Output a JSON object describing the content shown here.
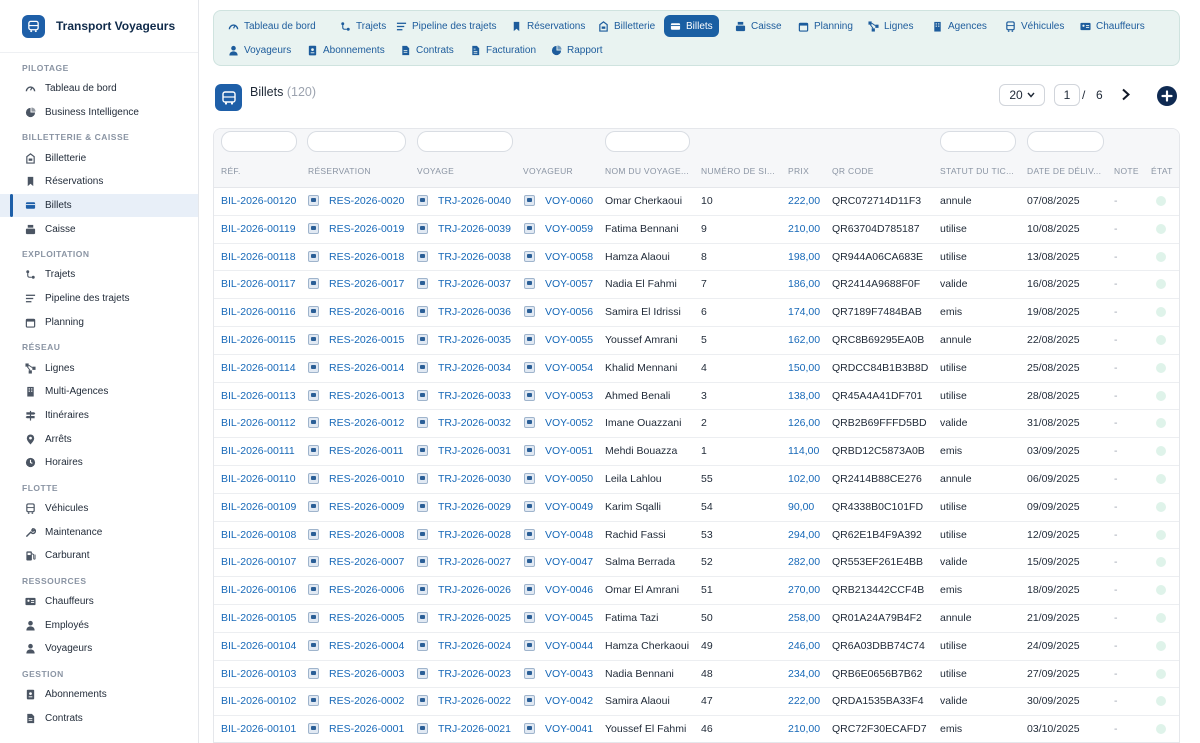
{
  "app": {
    "title": "Transport Voyageurs"
  },
  "sidebar": {
    "sections": [
      {
        "title": "PILOTAGE",
        "items": [
          {
            "label": "Tableau de bord",
            "icon": "gauge-icon"
          },
          {
            "label": "Business Intelligence",
            "icon": "chart-pie-icon"
          }
        ]
      },
      {
        "title": "BILLETTERIE & CAISSE",
        "items": [
          {
            "label": "Billetterie",
            "icon": "ticket-booth-icon"
          },
          {
            "label": "Réservations",
            "icon": "bookmark-icon"
          },
          {
            "label": "Billets",
            "icon": "ticket-icon",
            "active": true
          },
          {
            "label": "Caisse",
            "icon": "cash-register-icon"
          }
        ]
      },
      {
        "title": "EXPLOITATION",
        "items": [
          {
            "label": "Trajets",
            "icon": "route-icon"
          },
          {
            "label": "Pipeline des trajets",
            "icon": "pipeline-icon"
          },
          {
            "label": "Planning",
            "icon": "calendar-icon"
          }
        ]
      },
      {
        "title": "RÉSEAU",
        "items": [
          {
            "label": "Lignes",
            "icon": "network-icon"
          },
          {
            "label": "Multi-Agences",
            "icon": "building-icon"
          },
          {
            "label": "Itinéraires",
            "icon": "signpost-icon"
          },
          {
            "label": "Arrêts",
            "icon": "map-pin-icon"
          },
          {
            "label": "Horaires",
            "icon": "clock-icon"
          }
        ]
      },
      {
        "title": "FLOTTE",
        "items": [
          {
            "label": "Véhicules",
            "icon": "bus-icon"
          },
          {
            "label": "Maintenance",
            "icon": "wrench-icon"
          },
          {
            "label": "Carburant",
            "icon": "fuel-icon"
          }
        ]
      },
      {
        "title": "RESSOURCES",
        "items": [
          {
            "label": "Chauffeurs",
            "icon": "id-card-icon"
          },
          {
            "label": "Employés",
            "icon": "user-tie-icon"
          },
          {
            "label": "Voyageurs",
            "icon": "user-icon"
          }
        ]
      },
      {
        "title": "GESTION",
        "items": [
          {
            "label": "Abonnements",
            "icon": "id-badge-icon"
          },
          {
            "label": "Contrats",
            "icon": "file-icon"
          }
        ]
      }
    ]
  },
  "tabs": [
    {
      "label": "Tableau de bord",
      "icon": "gauge-icon"
    },
    {
      "label": "Trajets",
      "icon": "route-icon"
    },
    {
      "label": "Pipeline des trajets",
      "icon": "pipeline-icon"
    },
    {
      "label": "Réservations",
      "icon": "bookmark-icon"
    },
    {
      "label": "Billetterie",
      "icon": "ticket-booth-icon"
    },
    {
      "label": "Billets",
      "icon": "ticket-icon",
      "active": true
    },
    {
      "label": "Caisse",
      "icon": "cash-register-icon"
    },
    {
      "label": "Planning",
      "icon": "calendar-icon"
    },
    {
      "label": "Lignes",
      "icon": "network-icon"
    },
    {
      "label": "Agences",
      "icon": "building-icon"
    },
    {
      "label": "Véhicules",
      "icon": "bus-icon"
    },
    {
      "label": "Chauffeurs",
      "icon": "id-card-icon"
    },
    {
      "label": "Voyageurs",
      "icon": "user-icon"
    },
    {
      "label": "Abonnements",
      "icon": "id-badge-icon"
    },
    {
      "label": "Contrats",
      "icon": "file-icon"
    },
    {
      "label": "Facturation",
      "icon": "invoice-icon"
    },
    {
      "label": "Rapport",
      "icon": "chart-pie-icon"
    }
  ],
  "page": {
    "title": "Billets",
    "count": "(120)"
  },
  "pagination": {
    "page_size": "20",
    "current_page": "1",
    "separator": "/",
    "total_pages": "6"
  },
  "table": {
    "columns": [
      "RÉF.",
      "RÉSERVATION",
      "VOYAGE",
      "VOYAGEUR",
      "NOM DU VOYAGE...",
      "NUMÉRO DE SI...",
      "PRIX",
      "QR CODE",
      "STATUT DU TIC...",
      "DATE DE DÉLIV...",
      "NOTE",
      "ÉTAT"
    ],
    "rows": [
      [
        "BIL-2026-00120",
        "RES-2026-0020",
        "TRJ-2026-0040",
        "VOY-0060",
        "Omar Cherkaoui",
        "10",
        "222,00",
        "QRC072714D11F3",
        "annule",
        "07/08/2025",
        "-"
      ],
      [
        "BIL-2026-00119",
        "RES-2026-0019",
        "TRJ-2026-0039",
        "VOY-0059",
        "Fatima Bennani",
        "9",
        "210,00",
        "QR63704D785187",
        "utilise",
        "10/08/2025",
        "-"
      ],
      [
        "BIL-2026-00118",
        "RES-2026-0018",
        "TRJ-2026-0038",
        "VOY-0058",
        "Hamza Alaoui",
        "8",
        "198,00",
        "QR944A06CA683E",
        "utilise",
        "13/08/2025",
        "-"
      ],
      [
        "BIL-2026-00117",
        "RES-2026-0017",
        "TRJ-2026-0037",
        "VOY-0057",
        "Nadia El Fahmi",
        "7",
        "186,00",
        "QR2414A9688F0F",
        "valide",
        "16/08/2025",
        "-"
      ],
      [
        "BIL-2026-00116",
        "RES-2026-0016",
        "TRJ-2026-0036",
        "VOY-0056",
        "Samira El Idrissi",
        "6",
        "174,00",
        "QR7189F7484BAB",
        "emis",
        "19/08/2025",
        "-"
      ],
      [
        "BIL-2026-00115",
        "RES-2026-0015",
        "TRJ-2026-0035",
        "VOY-0055",
        "Youssef Amrani",
        "5",
        "162,00",
        "QRC8B69295EA0B",
        "annule",
        "22/08/2025",
        "-"
      ],
      [
        "BIL-2026-00114",
        "RES-2026-0014",
        "TRJ-2026-0034",
        "VOY-0054",
        "Khalid Mennani",
        "4",
        "150,00",
        "QRDCC84B1B3B8D",
        "utilise",
        "25/08/2025",
        "-"
      ],
      [
        "BIL-2026-00113",
        "RES-2026-0013",
        "TRJ-2026-0033",
        "VOY-0053",
        "Ahmed Benali",
        "3",
        "138,00",
        "QR45A4A41DF701",
        "utilise",
        "28/08/2025",
        "-"
      ],
      [
        "BIL-2026-00112",
        "RES-2026-0012",
        "TRJ-2026-0032",
        "VOY-0052",
        "Imane Ouazzani",
        "2",
        "126,00",
        "QRB2B69FFFD5BD",
        "valide",
        "31/08/2025",
        "-"
      ],
      [
        "BIL-2026-00111",
        "RES-2026-0011",
        "TRJ-2026-0031",
        "VOY-0051",
        "Mehdi Bouazza",
        "1",
        "114,00",
        "QRBD12C5873A0B",
        "emis",
        "03/09/2025",
        "-"
      ],
      [
        "BIL-2026-00110",
        "RES-2026-0010",
        "TRJ-2026-0030",
        "VOY-0050",
        "Leila Lahlou",
        "55",
        "102,00",
        "QR2414B88CE276",
        "annule",
        "06/09/2025",
        "-"
      ],
      [
        "BIL-2026-00109",
        "RES-2026-0009",
        "TRJ-2026-0029",
        "VOY-0049",
        "Karim Sqalli",
        "54",
        "90,00",
        "QR4338B0C101FD",
        "utilise",
        "09/09/2025",
        "-"
      ],
      [
        "BIL-2026-00108",
        "RES-2026-0008",
        "TRJ-2026-0028",
        "VOY-0048",
        "Rachid Fassi",
        "53",
        "294,00",
        "QR62E1B4F9A392",
        "utilise",
        "12/09/2025",
        "-"
      ],
      [
        "BIL-2026-00107",
        "RES-2026-0007",
        "TRJ-2026-0027",
        "VOY-0047",
        "Salma Berrada",
        "52",
        "282,00",
        "QR553EF261E4BB",
        "valide",
        "15/09/2025",
        "-"
      ],
      [
        "BIL-2026-00106",
        "RES-2026-0006",
        "TRJ-2026-0026",
        "VOY-0046",
        "Omar El Amrani",
        "51",
        "270,00",
        "QRB213442CCF4B",
        "emis",
        "18/09/2025",
        "-"
      ],
      [
        "BIL-2026-00105",
        "RES-2026-0005",
        "TRJ-2026-0025",
        "VOY-0045",
        "Fatima Tazi",
        "50",
        "258,00",
        "QR01A24A79B4F2",
        "annule",
        "21/09/2025",
        "-"
      ],
      [
        "BIL-2026-00104",
        "RES-2026-0004",
        "TRJ-2026-0024",
        "VOY-0044",
        "Hamza Cherkaoui",
        "49",
        "246,00",
        "QR6A03DBB74C74",
        "utilise",
        "24/09/2025",
        "-"
      ],
      [
        "BIL-2026-00103",
        "RES-2026-0003",
        "TRJ-2026-0023",
        "VOY-0043",
        "Nadia Bennani",
        "48",
        "234,00",
        "QRB6E0656B7B62",
        "utilise",
        "27/09/2025",
        "-"
      ],
      [
        "BIL-2026-00102",
        "RES-2026-0002",
        "TRJ-2026-0022",
        "VOY-0042",
        "Samira Alaoui",
        "47",
        "222,00",
        "QRDA1535BA33F4",
        "valide",
        "30/09/2025",
        "-"
      ],
      [
        "BIL-2026-00101",
        "RES-2026-0001",
        "TRJ-2026-0021",
        "VOY-0041",
        "Youssef El Fahmi",
        "46",
        "210,00",
        "QRC72F30ECAFD7",
        "emis",
        "03/10/2025",
        "-"
      ]
    ]
  },
  "colors": {
    "accent": "#1a5fa3",
    "link": "#1668b8",
    "tabbar_bg": "#e9f3f1",
    "status_dot": "#dff3ea",
    "brand": "#1e5fa8"
  }
}
